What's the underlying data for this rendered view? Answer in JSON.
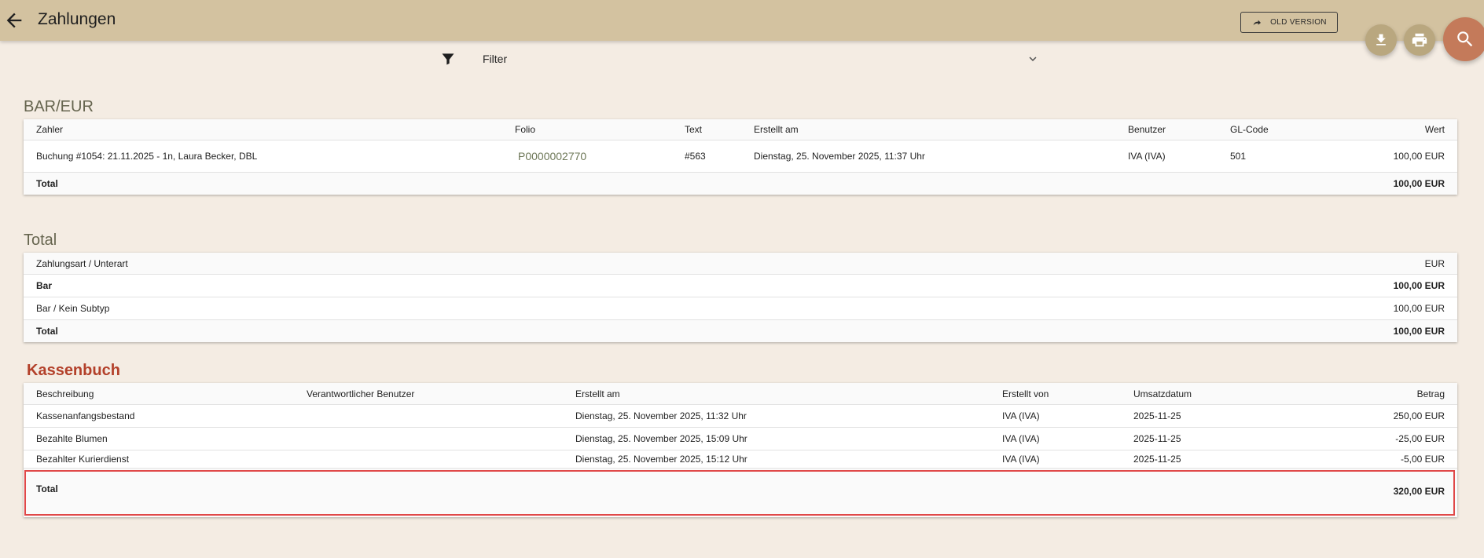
{
  "header": {
    "title": "Zahlungen",
    "old_version_label": "OLD VERSION"
  },
  "filter": {
    "label": "Filter"
  },
  "bar_section": {
    "title": "BAR/EUR",
    "columns": {
      "payer": "Zahler",
      "folio": "Folio",
      "text": "Text",
      "created": "Erstellt am",
      "user": "Benutzer",
      "gl_code": "GL-Code",
      "value": "Wert"
    },
    "rows": [
      {
        "payer": "Buchung #1054: 21.11.2025 - 1n, Laura Becker, DBL",
        "folio": "P0000002770",
        "text": "#563",
        "created": "Dienstag, 25. November 2025, 11:37 Uhr",
        "user": "IVA (IVA)",
        "gl_code": "501",
        "value": "100,00 EUR"
      }
    ],
    "total_label": "Total",
    "total_value": "100,00 EUR"
  },
  "total_section": {
    "title": "Total",
    "columns": {
      "type": "Zahlungsart / Unterart",
      "currency": "EUR"
    },
    "rows": [
      {
        "type": "Bar",
        "value": "100,00 EUR"
      },
      {
        "type": "Bar / Kein Subtyp",
        "value": "100,00 EUR"
      }
    ],
    "total_label": "Total",
    "total_value": "100,00 EUR"
  },
  "cashbook_section": {
    "title": "Kassenbuch",
    "columns": {
      "description": "Beschreibung",
      "responsible": "Verantwortlicher Benutzer",
      "created": "Erstellt am",
      "created_by": "Erstellt von",
      "sales_date": "Umsatzdatum",
      "amount": "Betrag"
    },
    "rows": [
      {
        "description": "Kassenanfangsbestand",
        "created": "Dienstag, 25. November 2025, 11:32 Uhr",
        "created_by": "IVA (IVA)",
        "sales_date": "2025-11-25",
        "amount": "250,00 EUR"
      },
      {
        "description": "Bezahlte Blumen",
        "created": "Dienstag, 25. November 2025, 15:09 Uhr",
        "created_by": "IVA (IVA)",
        "sales_date": "2025-11-25",
        "amount": "-25,00 EUR"
      },
      {
        "description": "Bezahlter Kurierdienst",
        "created": "Dienstag, 25. November 2025, 15:12 Uhr",
        "created_by": "IVA (IVA)",
        "sales_date": "2025-11-25",
        "amount": "-5,00 EUR"
      }
    ],
    "total_label": "Total",
    "total_value": "320,00 EUR"
  },
  "colors": {
    "header": "#d3c2a0",
    "background": "#f4ece3",
    "accent_red": "#b3402a",
    "fab_search": "#c47a5a",
    "highlight": "#e04848"
  }
}
